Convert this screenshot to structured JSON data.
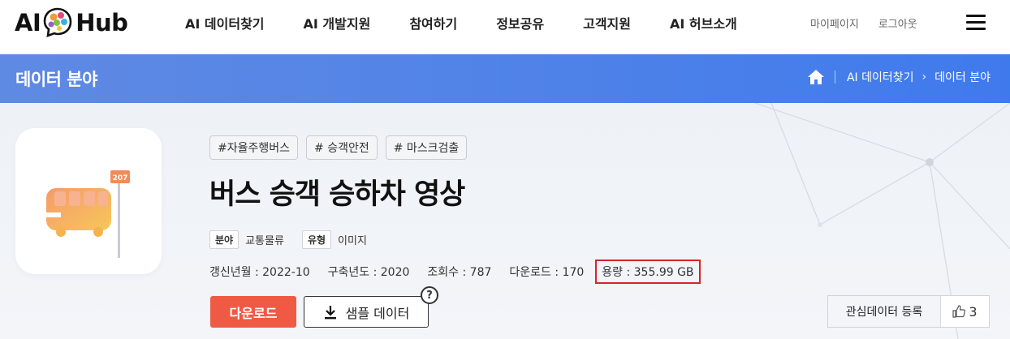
{
  "header": {
    "logo_left": "AI",
    "logo_right": "Hub",
    "nav": [
      "AI 데이터찾기",
      "AI 개발지원",
      "참여하기",
      "정보공유",
      "고객지원",
      "AI 허브소개"
    ],
    "util": [
      "마이페이지",
      "로그아웃"
    ],
    "menu_icon": "hamburger-icon"
  },
  "banner": {
    "title": "데이터 분야",
    "breadcrumb": [
      "AI 데이터찾기",
      "데이터 분야"
    ],
    "home_icon": "home-icon"
  },
  "dataset": {
    "thumbnail_icon": "bus-stop-icon",
    "bus_stop_number": "207",
    "tags": [
      "#자율주행버스",
      "# 승객안전",
      "# 마스크검출"
    ],
    "title": "버스 승객 승하차 영상",
    "field_label": "분야",
    "field_value": "교통물류",
    "type_label": "유형",
    "type_value": "이미지",
    "updated": "갱신년월 : 2022-10",
    "built": "구축년도 : 2020",
    "views": "조회수 : 787",
    "downloads": "다운로드 : 170",
    "size": "용량 : 355.99 GB"
  },
  "actions": {
    "download": "다운로드",
    "sample": "샘플 데이터",
    "help": "?",
    "favorite": "관심데이터 등록",
    "likes": "3"
  },
  "colors": {
    "accent_blue": "#4f82e8",
    "download_red": "#ef5a45",
    "highlight_red": "#d6232b"
  }
}
